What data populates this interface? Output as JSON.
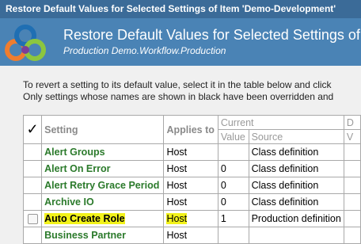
{
  "window": {
    "title": "Restore Default Values for Selected Settings of Item 'Demo-Development'"
  },
  "header": {
    "title": "Restore Default Values for Selected Settings of",
    "subtitle": "Production Demo.Workflow.Production"
  },
  "instructions": {
    "line1": "To revert a setting to its default value, select it in the table below and click",
    "line2": "Only settings whose names are shown in black have been overridden and"
  },
  "table": {
    "headers": {
      "check": "✓",
      "setting": "Setting",
      "applies_to": "Applies to",
      "current": "Current",
      "value": "Value",
      "source": "Source",
      "d": "D",
      "v": "V"
    },
    "rows": [
      {
        "setting": "Alert Groups",
        "applies_to": "Host",
        "value": "",
        "source": "Class definition"
      },
      {
        "setting": "Alert On Error",
        "applies_to": "Host",
        "value": "0",
        "source": "Class definition"
      },
      {
        "setting": "Alert Retry Grace Period",
        "applies_to": "Host",
        "value": "0",
        "source": "Class definition"
      },
      {
        "setting": "Archive IO",
        "applies_to": "Host",
        "value": "0",
        "source": "Class definition"
      },
      {
        "setting": "Auto Create Role",
        "applies_to": "Host",
        "value": "1",
        "source": "Production definition"
      },
      {
        "setting": "Business Partner",
        "applies_to": "Host",
        "value": "",
        "source": ""
      }
    ]
  }
}
